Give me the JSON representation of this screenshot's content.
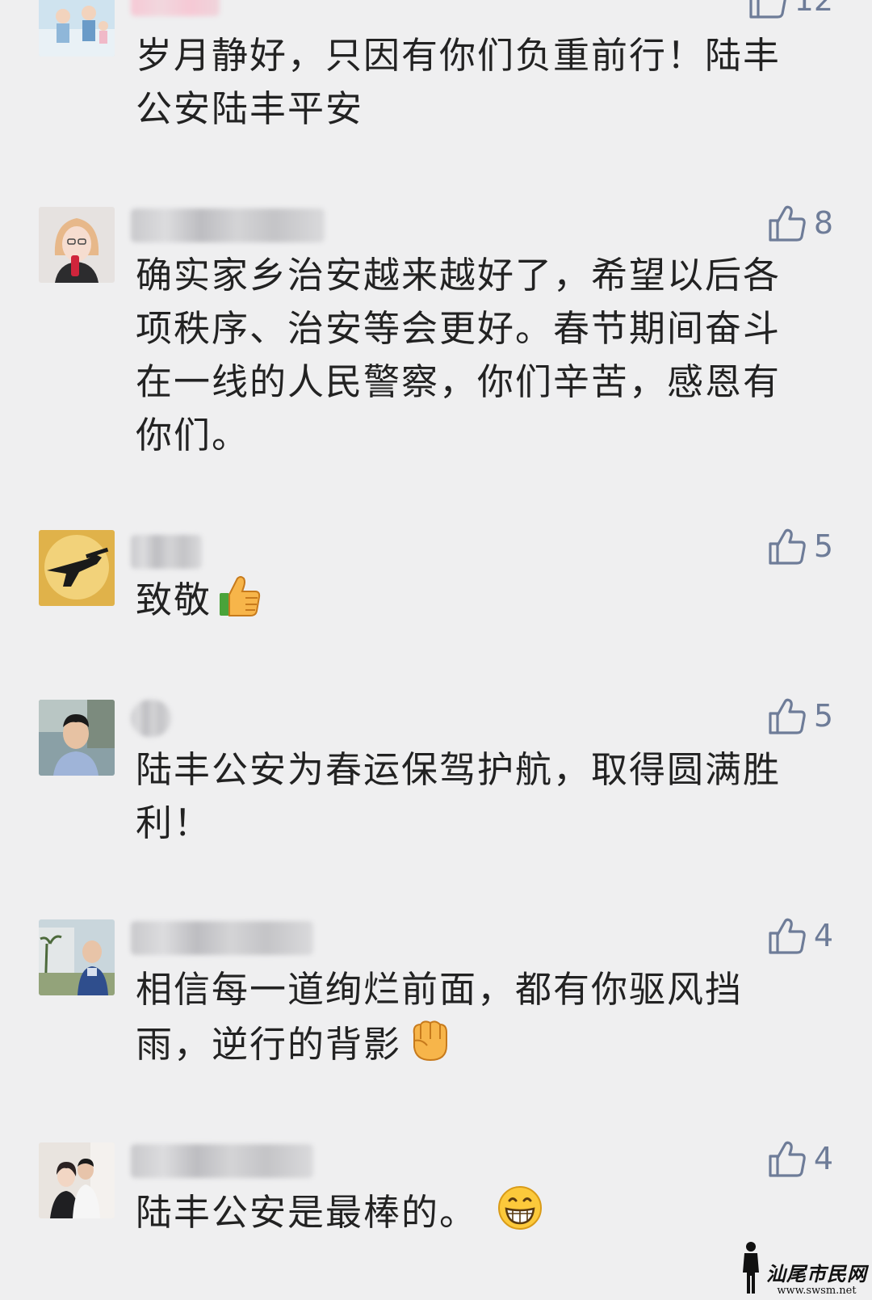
{
  "comments": [
    {
      "likes": "12",
      "lines": [
        "岁月静好，只因有你们负重前行！陆丰",
        "公安陆丰平安"
      ]
    },
    {
      "likes": "8",
      "lines": [
        "确实家乡治安越来越好了，希望以后各",
        "项秩序、治安等会更好。春节期间奋斗",
        "在一线的人民警察，你们辛苦，感恩有",
        "你们。"
      ]
    },
    {
      "likes": "5",
      "lines": [
        "致敬"
      ],
      "emoji": "thumbs-up-emoji"
    },
    {
      "likes": "5",
      "lines": [
        "陆丰公安为春运保驾护航，取得圆满胜",
        "利！"
      ]
    },
    {
      "likes": "4",
      "lines": [
        "相信每一道绚烂前面，都有你驱风挡",
        "雨，逆行的背影"
      ],
      "emoji": "raised-fist-emoji"
    },
    {
      "likes": "4",
      "lines": [
        "陆丰公安是最棒的。"
      ],
      "emoji": "grinning-face-emoji"
    }
  ],
  "watermark": {
    "name": "汕尾市民网",
    "url": "www.swsm.net"
  },
  "colors": {
    "background": "#efeff0",
    "text": "#222222",
    "like": "#6e7c98"
  },
  "icons": {
    "like": "thumbs-up-outline-icon"
  }
}
